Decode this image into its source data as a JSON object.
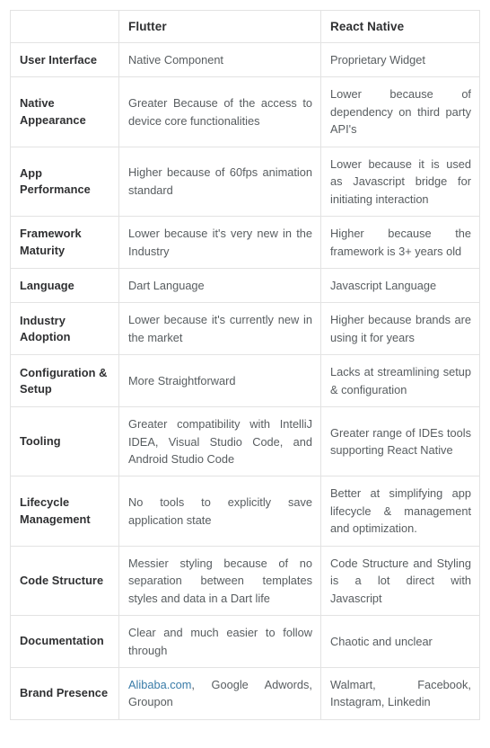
{
  "table": {
    "columns": [
      {
        "key": "feature",
        "label": ""
      },
      {
        "key": "flutter",
        "label": "Flutter"
      },
      {
        "key": "react_native",
        "label": "React Native"
      }
    ],
    "link_color": "#3a7ca8",
    "border_color": "#e3e3e3",
    "header_text_color": "#2f3032",
    "body_text_color": "#585d60",
    "rows": [
      {
        "feature": "User Interface",
        "flutter": "Native Component",
        "react_native": "Proprietary Widget"
      },
      {
        "feature": "Native Appearance",
        "flutter": "Greater Because of the access to device core functionalities",
        "react_native": "Lower because of dependency on third party API's"
      },
      {
        "feature": "App Performance",
        "flutter": "Higher because of 60fps animation standard",
        "react_native": "Lower because it is used as Javascript bridge for initiating interaction"
      },
      {
        "feature": "Framework Maturity",
        "flutter": "Lower because it's very new in the Industry",
        "react_native": "Higher because the framework is 3+ years old"
      },
      {
        "feature": "Language",
        "flutter": "Dart Language",
        "react_native": "Javascript Language"
      },
      {
        "feature": "Industry Adoption",
        "flutter": "Lower because it's currently new in the market",
        "react_native": "Higher because brands are using it for years"
      },
      {
        "feature": "Configuration & Setup",
        "flutter": "More Straightforward",
        "react_native": "Lacks at streamlining setup & configuration"
      },
      {
        "feature": "Tooling",
        "flutter": "Greater compatibility with IntelliJ IDEA, Visual Studio Code, and Android Studio Code",
        "react_native": "Greater range of IDEs tools supporting React Native"
      },
      {
        "feature": "Lifecycle Management",
        "flutter": "No tools to explicitly save application state",
        "react_native": "Better at simplifying app lifecycle & management and optimization."
      },
      {
        "feature": "Code Structure",
        "flutter": "Messier styling because of no separation between templates styles and data in a Dart life",
        "react_native": "Code Structure and Styling is a lot direct with Javascript"
      },
      {
        "feature": "Documentation",
        "flutter": "Clear and much easier to follow through",
        "react_native": "Chaotic and unclear"
      },
      {
        "feature": "Brand Presence",
        "flutter_link": "Alibaba.com",
        "flutter": ", Google Adwords, Groupon",
        "react_native": "Walmart, Facebook, Instagram, Linkedin"
      }
    ]
  }
}
